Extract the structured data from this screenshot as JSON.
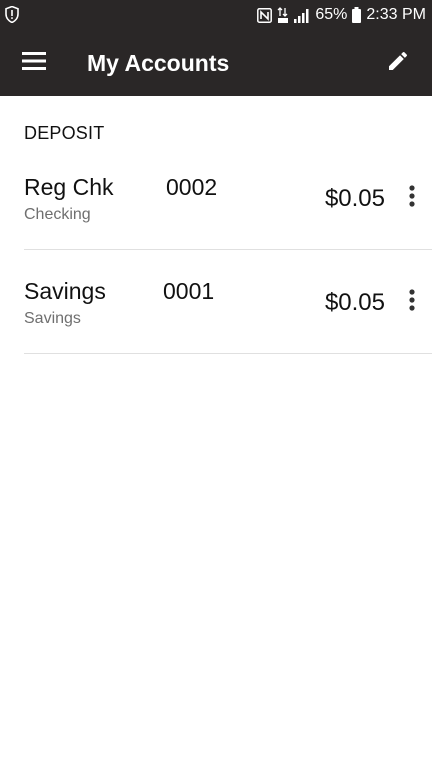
{
  "status_bar": {
    "battery": "65%",
    "time": "2:33 PM"
  },
  "app_bar": {
    "title": "My Accounts",
    "menu_icon": "hamburger-menu-icon",
    "edit_icon": "pencil-icon"
  },
  "section": {
    "title": "DEPOSIT"
  },
  "accounts": [
    {
      "name": "Reg Chk",
      "type": "Checking",
      "number": "0002",
      "balance": "$0.05"
    },
    {
      "name": "Savings",
      "type": "Savings",
      "number": "0001",
      "balance": "$0.05"
    }
  ],
  "colors": {
    "app_bar_bg": "#2a2727",
    "divider": "#e0e0e0",
    "secondary_text": "#6f6f6f"
  }
}
